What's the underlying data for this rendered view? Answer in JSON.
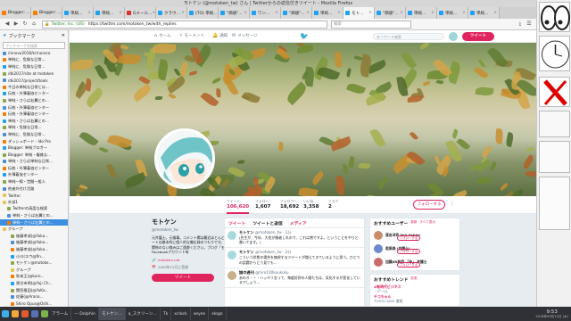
{
  "window": {
    "title": "モトケン (@motoken_tw) さん | Twitterからの返信付きツイート - Mozilla Firefox"
  },
  "tabs": [
    {
      "label": "Blogger: …",
      "color": "#f57d00",
      "active": false
    },
    {
      "label": "Blogger: …",
      "color": "#f57d00",
      "active": false
    },
    {
      "label": "単純…",
      "color": "#1da1f2",
      "active": false
    },
    {
      "label": "単純…",
      "color": "#1da1f2",
      "active": false
    },
    {
      "label": "Gメール…",
      "color": "#d93025",
      "active": false
    },
    {
      "label": "クラウ…",
      "color": "#1da1f2",
      "active": false
    },
    {
      "label": "(TO) 単純…",
      "color": "#1da1f2",
      "active": false
    },
    {
      "label": "\"価値\"…",
      "color": "#1da1f2",
      "active": false
    },
    {
      "label": "ワン…",
      "color": "#1da1f2",
      "active": false
    },
    {
      "label": "\"価値\"…",
      "color": "#1da1f2",
      "active": false
    },
    {
      "label": "単純…",
      "color": "#1da1f2",
      "active": false
    },
    {
      "label": "モト…",
      "color": "#1da1f2",
      "active": true
    },
    {
      "label": "\"価値\"…",
      "color": "#1da1f2",
      "active": false
    },
    {
      "label": "単純…",
      "color": "#1da1f2",
      "active": false
    },
    {
      "label": "単純…",
      "color": "#1da1f2",
      "active": false
    },
    {
      "label": "単純…",
      "color": "#1da1f2",
      "active": false
    }
  ],
  "navbar": {
    "site_identity": "Twitter, Inc. (US)",
    "url": "https://twitter.com/motoken_tw/with_replies",
    "search_placeholder": "検索"
  },
  "sidebar": {
    "title": "ブックマーク",
    "search_placeholder": "ブックマークを検索",
    "items": [
      {
        "label": "/innovo2016/kr/noreco",
        "kind": "page",
        "selected": false
      },
      {
        "label": "単純に、危険な日常...",
        "kind": "page",
        "selected": false
      },
      {
        "label": "単純に、危険な日常...",
        "kind": "page",
        "selected": false
      },
      {
        "label": "/dk2017/site at motoken",
        "kind": "page",
        "selected": false
      },
      {
        "label": "/dk2017/project/tools",
        "kind": "page",
        "selected": false
      },
      {
        "label": "今日の単純な日常とは...",
        "kind": "page",
        "selected": false
      },
      {
        "label": "伝統・外薄着協センター",
        "kind": "page",
        "selected": false
      },
      {
        "label": "単純・さらば右翼との...",
        "kind": "page",
        "selected": false
      },
      {
        "label": "伝統・外薄着協センター",
        "kind": "page",
        "selected": false
      },
      {
        "label": "伝統・外薄着協センター",
        "kind": "page",
        "selected": false
      },
      {
        "label": "単純・さらば右翼との...",
        "kind": "page",
        "selected": false
      },
      {
        "label": "単純・危険な日常...",
        "kind": "page",
        "selected": false
      },
      {
        "label": "単純に、危険な日常...",
        "kind": "page",
        "selected": false
      },
      {
        "label": "ダッシュボード - Ido Pro",
        "kind": "page",
        "selected": false
      },
      {
        "label": "Blogger: 単純ブロガー",
        "kind": "page",
        "selected": false
      },
      {
        "label": "Blogger: 単純・複雑な...",
        "kind": "page",
        "selected": false
      },
      {
        "label": "単純・さらば単純な日常...",
        "kind": "page",
        "selected": false
      },
      {
        "label": "伝統・外薄着協センター",
        "kind": "page",
        "selected": false
      },
      {
        "label": "外薄着協センター",
        "kind": "page",
        "selected": false
      },
      {
        "label": "単純一線・世間一般人",
        "kind": "page",
        "selected": false
      },
      {
        "label": "他者外付け活路",
        "kind": "page",
        "selected": false
      },
      {
        "label": "Twitter",
        "kind": "folder",
        "selected": false
      },
      {
        "label": "外部1",
        "kind": "folder",
        "selected": false
      },
      {
        "label": "Twitterの高度な検索",
        "kind": "page",
        "selected": false
      },
      {
        "label": "単純・さらば右翼との...",
        "kind": "page",
        "selected": false
      },
      {
        "label": "単純・さらば右翼との...",
        "kind": "page",
        "selected": true
      },
      {
        "label": "グループ",
        "kind": "folder",
        "selected": false
      },
      {
        "label": "後藤孝成(@Yuka...",
        "kind": "page",
        "selected": false
      },
      {
        "label": "後藤孝成(@Yuka...",
        "kind": "page",
        "selected": false
      },
      {
        "label": "後藤孝成(@Yuka...",
        "kind": "page",
        "selected": false
      },
      {
        "label": "小川(ユウ@fin...",
        "kind": "page",
        "selected": false
      },
      {
        "label": "モトケン@motoke...",
        "kind": "page",
        "selected": false
      },
      {
        "label": "グループ",
        "kind": "folder",
        "selected": false
      },
      {
        "label": "秋本王(@kuro...",
        "kind": "page",
        "selected": false
      },
      {
        "label": "黒谷市明(@Yuji Ch...",
        "kind": "page",
        "selected": false
      },
      {
        "label": "関西植田(@YuKa...",
        "kind": "page",
        "selected": false
      },
      {
        "label": "佐藤(@Arana...",
        "kind": "page",
        "selected": false
      },
      {
        "label": "Shiro Opus@Oshi...",
        "kind": "page",
        "selected": false
      },
      {
        "label": "Tukasa Kamakasami...",
        "kind": "page",
        "selected": false
      },
      {
        "label": "高木(@NOSHI...",
        "kind": "page",
        "selected": false
      },
      {
        "label": "ライト(@Yuka...",
        "kind": "page",
        "selected": false
      }
    ]
  },
  "twitter_nav": {
    "home": "ホーム",
    "moments": "モーメント",
    "notifications": "通知",
    "messages": "メッセージ",
    "search_placeholder": "キーワード検索",
    "tweet_button": "ツイート"
  },
  "stats": [
    {
      "label": "ツイート",
      "value": "106,620",
      "active": true
    },
    {
      "label": "フォロー",
      "value": "1,607",
      "active": false
    },
    {
      "label": "フォロワー",
      "value": "18,692",
      "active": false
    },
    {
      "label": "いいね",
      "value": "3,358",
      "active": false
    },
    {
      "label": "リスト",
      "value": "2",
      "active": false
    }
  ],
  "follow_button": "フォローする",
  "profile": {
    "name": "モトケン",
    "handle": "@motoken_tw",
    "bio": "元弁護士。元検事。コメント欄は最近ほとんど見ていません。ツイートは基本的に個人的な備忘録のつもりです。スパムは即ブロック。関係のない絡みはご遠慮ください。ブログ「モトケンのブログ」 Facebookアカウント有",
    "location": "motoken.net",
    "joined": "2009年12月に登録",
    "tweet_button": "ツイート"
  },
  "timeline": {
    "tabs": [
      "ツイート",
      "ツイートと返信",
      "メディア"
    ],
    "tweets": [
      {
        "name": "モトケン",
        "handle": "@motoken_tw · 1分",
        "text": "(先生が、今年、大佐が勝者しれので、これは賞ですよ。ということをやりと書いてます。)"
      },
      {
        "name": "モトケン",
        "handle": "@motoken_tw · 2分",
        "text": "こういう状態の場合を無視するツイートが増えてきているように思う。ひとつの話題からどう見ても…"
      },
      {
        "name": "謎の週刊",
        "handle": "@hiro100koukoku",
        "text": "あのオ・・・ハッキリ言って、毎度好評の人間たちは、気化するが変化しているでしょう…"
      }
    ]
  },
  "who_to_follow": {
    "title": "おすすめユーザー",
    "update": "更新",
    "view_all": "すべて表示",
    "users": [
      {
        "name": "落合洋司 Yoji Ochiai",
        "button": "フォローする",
        "color": "#c98b6b"
      },
      {
        "name": "若原森 (弁護士)",
        "button": "フォローする",
        "color": "#6b8ac9"
      },
      {
        "name": "加藤JIN和欣 「赤」 弁護士",
        "button": "フォローする",
        "color": "#c96b6b"
      }
    ]
  },
  "trends": {
    "title": "おすすめトレンド",
    "change": "変更",
    "items": [
      {
        "text": "#新時代ビジネス",
        "kind": "tag"
      },
      {
        "text": "・ゲーム",
        "kind": "meta"
      },
      {
        "text": "チコちゃん",
        "kind": "tag"
      },
      {
        "text": "TOKYO KIDS 番組",
        "kind": "meta"
      }
    ]
  },
  "taskbar": {
    "items": [
      {
        "label": "アラーム",
        "active": false
      },
      {
        "label": "— Dolphin",
        "active": false
      },
      {
        "label": "モトケン...",
        "active": true
      },
      {
        "label": "a_スクリーン...",
        "active": false
      },
      {
        "label": "Tk",
        "active": false
      },
      {
        "label": "xclock",
        "active": false
      },
      {
        "label": "xeyes",
        "active": false
      },
      {
        "label": "xlogo",
        "active": false
      }
    ],
    "time": "9:53",
    "date": "2018年09月12日 (水)"
  }
}
